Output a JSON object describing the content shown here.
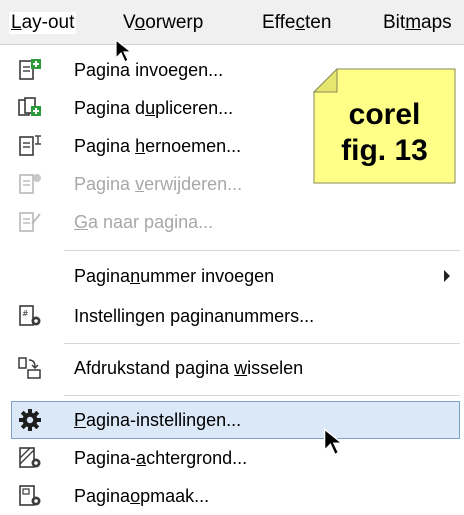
{
  "menubar": {
    "items": [
      {
        "label": "Lay-out",
        "underline": "L"
      },
      {
        "label": "Voorwerp",
        "underline": "o"
      },
      {
        "label": "Effecten",
        "underline": "c"
      },
      {
        "label": "Bitmaps",
        "underline": "m"
      }
    ]
  },
  "menu": {
    "items": [
      {
        "pre": "Pa",
        "u": "g",
        "post": "ina invoegen...",
        "icon": "page-insert-icon",
        "disabled": false
      },
      {
        "pre": "Pagina d",
        "u": "u",
        "post": "pliceren...",
        "icon": "page-duplicate-icon",
        "disabled": false
      },
      {
        "pre": "Pagina ",
        "u": "h",
        "post": "ernoemen...",
        "icon": "page-rename-icon",
        "disabled": false
      },
      {
        "pre": "Pagina ",
        "u": "v",
        "post": "erwijderen...",
        "icon": "page-delete-icon",
        "disabled": true
      },
      {
        "pre": "",
        "u": "G",
        "post": "a naar pagina...",
        "icon": "go-to-page-icon",
        "disabled": true
      },
      {
        "pre": "Pagina",
        "u": "n",
        "post": "ummer invoegen",
        "icon": "",
        "disabled": false,
        "submenu": true
      },
      {
        "pre": "Instellingen pa",
        "u": "g",
        "post": "inanummers...",
        "icon": "page-number-settings-icon",
        "disabled": false
      },
      {
        "pre": "Afdrukstand pagina ",
        "u": "w",
        "post": "isselen",
        "icon": "switch-orientation-icon",
        "disabled": false
      },
      {
        "pre": "",
        "u": "P",
        "post": "agina-instellingen...",
        "icon": "gear-icon",
        "disabled": false,
        "highlighted": true
      },
      {
        "pre": "Pagina-",
        "u": "a",
        "post": "chtergrond...",
        "icon": "page-background-icon",
        "disabled": false
      },
      {
        "pre": "Pagina",
        "u": "o",
        "post": "pmaak...",
        "icon": "page-layout-icon",
        "disabled": false
      }
    ]
  },
  "note": {
    "line1": "corel",
    "line2": "fig. 13",
    "color": "#ffff88"
  }
}
